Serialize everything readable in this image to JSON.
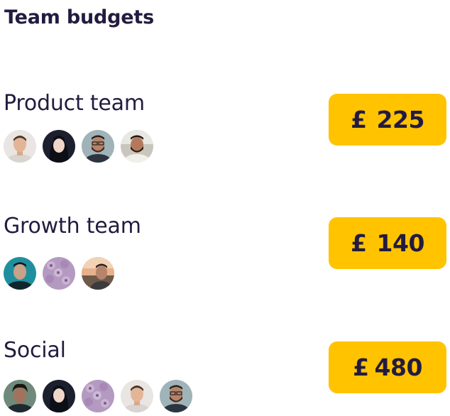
{
  "page_title": "Team budgets",
  "accent_color": "#ffc300",
  "text_color": "#231b3f",
  "teams": [
    {
      "name": "Product team",
      "currency": "£",
      "amount": "225",
      "members": [
        "man-light-shirt",
        "woman-dark-hair",
        "man-glasses-beard",
        "man-beard-outdoor"
      ]
    },
    {
      "name": "Growth team",
      "currency": "£",
      "amount": "140",
      "members": [
        "man-teal-background",
        "donut-pattern",
        "man-sunset-outdoor"
      ]
    },
    {
      "name": "Social",
      "currency": "£",
      "amount": "480",
      "members": [
        "man-curly-hair-outdoor",
        "woman-dark-hair",
        "donut-pattern",
        "man-light-shirt",
        "man-glasses-beard"
      ]
    }
  ]
}
